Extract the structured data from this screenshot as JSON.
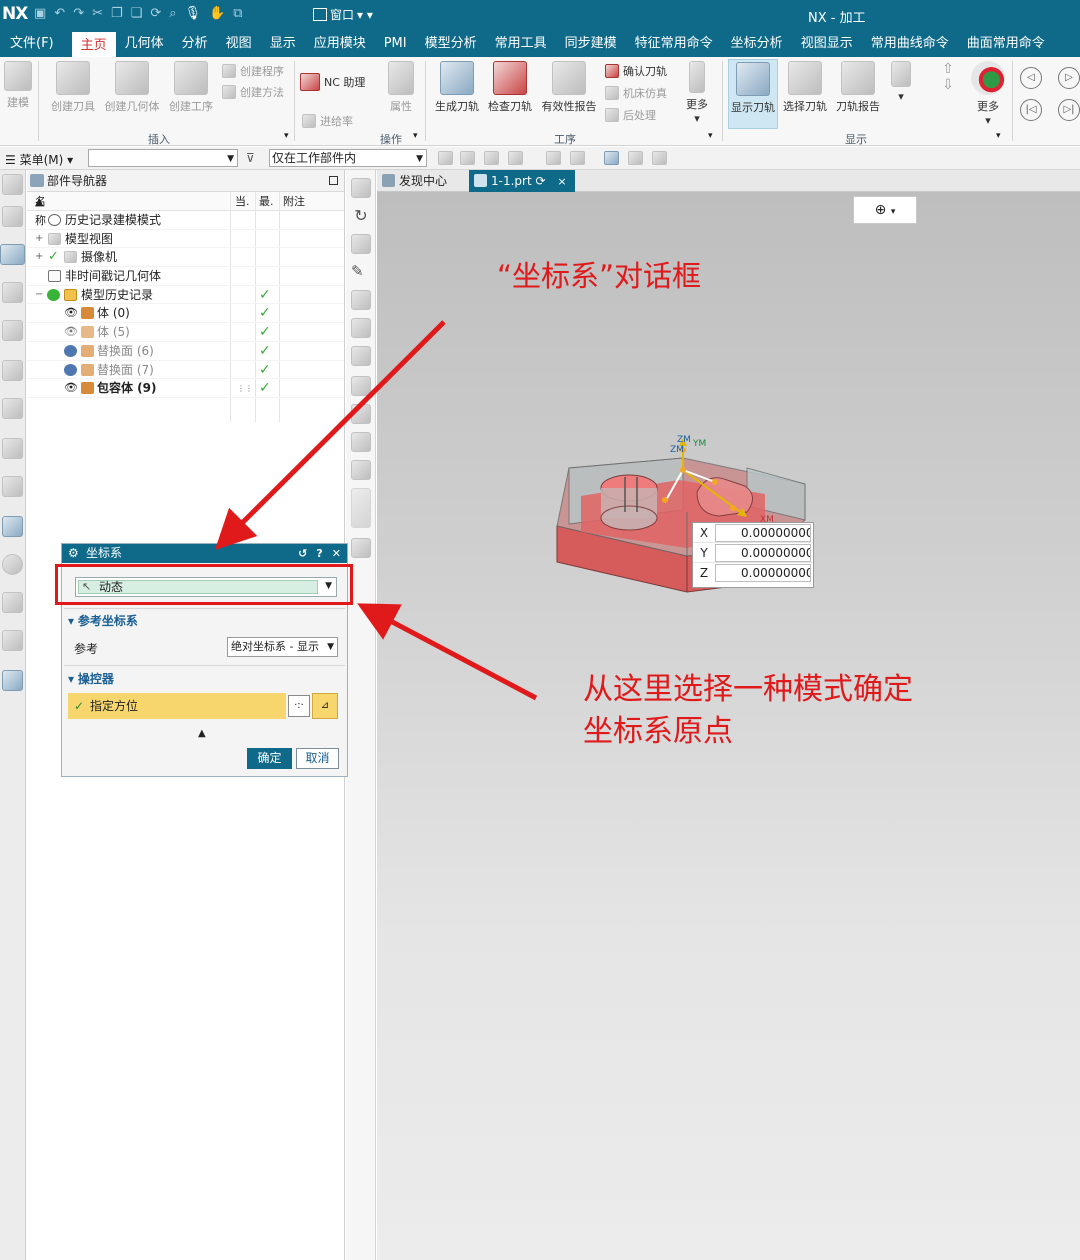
{
  "titlebar": {
    "logo": "NX",
    "window_menu": "窗口",
    "app_title": "NX - 加工"
  },
  "menu_tabs": [
    "文件(F)",
    "主页",
    "几何体",
    "分析",
    "视图",
    "显示",
    "应用模块",
    "PMI",
    "模型分析",
    "常用工具",
    "同步建模",
    "特征常用命令",
    "坐标分析",
    "视图显示",
    "常用曲线命令",
    "曲面常用命令"
  ],
  "active_tab": "主页",
  "ribbon": {
    "tools": {
      "build": "建模",
      "create_tool": "创建刀具",
      "create_geometry": "创建几何体",
      "create_operation": "创建工序",
      "create_program": "创建程序",
      "create_method": "创建方法",
      "nc_assistant": "NC 助理",
      "property": "属性",
      "feed_rate": "进给率",
      "generate_path": "生成刀轨",
      "verify_path": "检查刀轨",
      "validity_report": "有效性报告",
      "confirm_path": "确认刀轨",
      "machine_sim": "机床仿真",
      "post_process": "后处理",
      "more1": "更多",
      "show_path": "显示刀轨",
      "select_path": "选择刀轨",
      "path_report": "刀轨报告",
      "more2": "更多"
    },
    "groups": {
      "insert": "插入",
      "operation": "操作",
      "process": "工序",
      "display": "显示"
    }
  },
  "toolbar2": {
    "menu": "菜单(M)",
    "filter_value": "",
    "scope": "仅在工作部件内"
  },
  "navigator": {
    "title": "部件导航器",
    "columns": {
      "name": "名称",
      "current": "当.",
      "latest": "最.",
      "note": "附注"
    },
    "rows": [
      {
        "label": "历史记录建模模式"
      },
      {
        "label": "模型视图"
      },
      {
        "label": "摄像机"
      },
      {
        "label": "非时间戳记几何体"
      },
      {
        "label": "模型历史记录"
      },
      {
        "label": "体 (0)"
      },
      {
        "label": "体 (5)"
      },
      {
        "label": "替换面 (6)"
      },
      {
        "label": "替换面 (7)"
      },
      {
        "label": "包容体 (9)"
      }
    ]
  },
  "graphics": {
    "tabs": [
      "发现中心",
      "1-1.prt"
    ],
    "axis_labels": {
      "zm": "ZM",
      "zmi": "ZM",
      "ym": "YM",
      "xm": "XM"
    },
    "coords": [
      {
        "axis": "X",
        "value": "0.00000000"
      },
      {
        "axis": "Y",
        "value": "0.00000000"
      },
      {
        "axis": "Z",
        "value": "0.00000000"
      }
    ]
  },
  "dialog": {
    "title": "坐标系",
    "type_value": "动态",
    "section_ref": "参考坐标系",
    "ref_label": "参考",
    "ref_value": "绝对坐标系 - 显示",
    "section_manip": "操控器",
    "specify": "指定方位",
    "ok": "确定",
    "cancel": "取消"
  },
  "annotations": {
    "dialog_note": "“坐标系”对话框",
    "mode_note_line1": "从这里选择一种模式确定",
    "mode_note_line2": "坐标系原点"
  },
  "colors": {
    "brand": "#0f6a8a",
    "annotation_red": "#e0191b",
    "active_tab_text": "#d03030",
    "manipulator_yellow": "#f8d66e"
  }
}
